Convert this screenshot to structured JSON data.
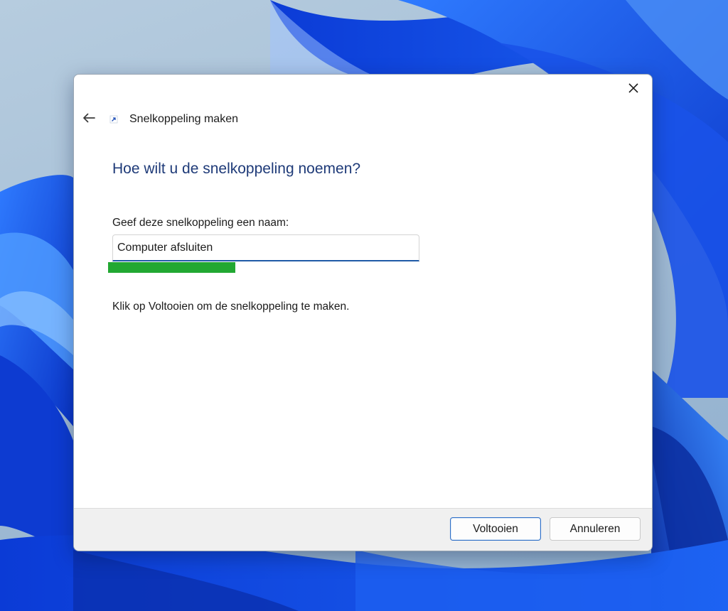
{
  "wizard": {
    "title": "Snelkoppeling maken",
    "heading": "Hoe wilt u de snelkoppeling noemen?",
    "name_label": "Geef deze snelkoppeling een naam:",
    "name_value": "Computer afsluiten",
    "hint": "Klik op Voltooien om de snelkoppeling te maken."
  },
  "buttons": {
    "finish_label": "Voltooien",
    "cancel_label": "Annuleren"
  },
  "icons": {
    "close": "close-icon",
    "back": "back-arrow-icon",
    "shortcut": "shortcut-arrow-icon"
  },
  "colors": {
    "heading": "#1e3a78",
    "accent": "#1f5aa6",
    "highlight": "#22a832",
    "footer": "#f0f0f0"
  }
}
